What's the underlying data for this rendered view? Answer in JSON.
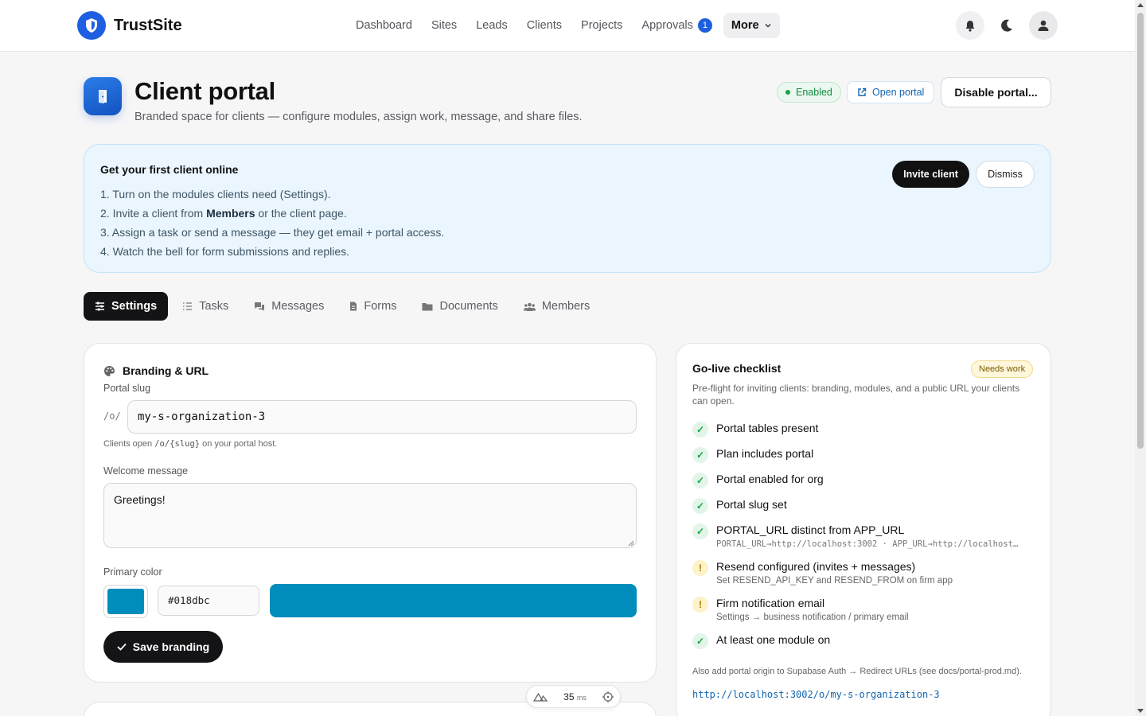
{
  "app": {
    "name": "TrustSite"
  },
  "nav": {
    "items": [
      "Dashboard",
      "Sites",
      "Leads",
      "Clients",
      "Projects"
    ],
    "approvals_label": "Approvals",
    "approvals_count": "1",
    "more_label": "More"
  },
  "header": {
    "title": "Client portal",
    "subtitle": "Branded space for clients — configure modules, assign work, message, and share files.",
    "status": "Enabled",
    "open_portal": "Open portal",
    "disable": "Disable portal..."
  },
  "onboarding": {
    "title": "Get your first client online",
    "step1": "1. Turn on the modules clients need (Settings).",
    "step2_pre": "2. Invite a client from ",
    "step2_bold": "Members",
    "step2_post": " or the client page.",
    "step3": "3. Assign a task or send a message — they get email + portal access.",
    "step4": "4. Watch the bell for form submissions and replies.",
    "invite": "Invite client",
    "dismiss": "Dismiss"
  },
  "tabs": [
    "Settings",
    "Tasks",
    "Messages",
    "Forms",
    "Documents",
    "Members"
  ],
  "branding": {
    "title": "Branding & URL",
    "slug_label": "Portal slug",
    "slug_prefix": "/o/",
    "slug_value": "my-s-organization-3",
    "hint_pre": "Clients open ",
    "hint_code": "/o/{slug}",
    "hint_post": " on your portal host.",
    "welcome_label": "Welcome message",
    "welcome_value": "Greetings!",
    "color_label": "Primary color",
    "color_value": "#018dbc",
    "save": "Save branding"
  },
  "checklist": {
    "title": "Go-live checklist",
    "badge": "Needs work",
    "subtitle": "Pre-flight for inviting clients: branding, modules, and a public URL your clients can open.",
    "items": [
      {
        "label": "Portal tables present",
        "status": "ok"
      },
      {
        "label": "Plan includes portal",
        "status": "ok"
      },
      {
        "label": "Portal enabled for org",
        "status": "ok"
      },
      {
        "label": "Portal slug set",
        "status": "ok"
      },
      {
        "label": "PORTAL_URL distinct from APP_URL",
        "status": "ok",
        "detail": "PORTAL_URL→http://localhost:3002 · APP_URL→http://localhost…"
      },
      {
        "label": "Resend configured (invites + messages)",
        "status": "warn",
        "detail": "Set RESEND_API_KEY and RESEND_FROM on firm app"
      },
      {
        "label": "Firm notification email",
        "status": "warn",
        "detail": "Settings → business notification / primary email"
      },
      {
        "label": "At least one module on",
        "status": "ok"
      }
    ],
    "note": "Also add portal origin to Supabase Auth → Redirect URLs (see docs/portal-prod.md).",
    "link": "http://localhost:3002/o/my-s-organization-3"
  },
  "perf": {
    "value": "35",
    "unit": "ms"
  },
  "colors": {
    "accent": "#1d5fe0",
    "brand_preview": "#018dbc"
  }
}
